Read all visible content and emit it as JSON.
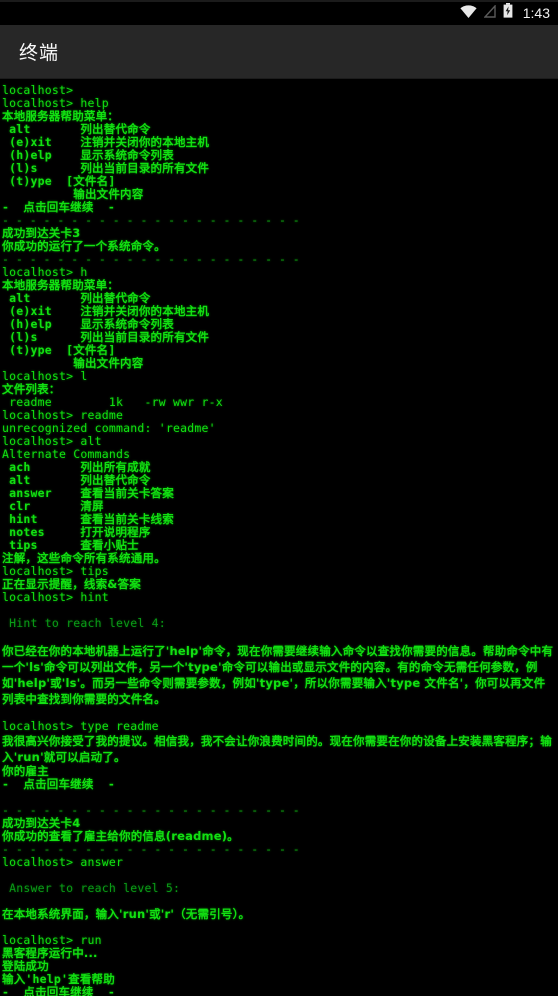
{
  "status_bar": {
    "time": "1:43",
    "icons": [
      "wifi-icon",
      "signal-off-icon",
      "battery-charging-icon"
    ]
  },
  "header": {
    "title": "终端"
  },
  "terminal": {
    "colors": {
      "background": "#000000",
      "text": "#12e012",
      "dim_text": "#0a9b18",
      "header_bg": "#272727",
      "header_text": "#fafafa"
    },
    "lines": [
      {
        "id": "l01",
        "text": "localhost>",
        "style": "mono"
      },
      {
        "id": "l02",
        "text": "localhost> help",
        "style": "mono"
      },
      {
        "id": "l03",
        "text": "本地服务器帮助菜单：",
        "style": "cjk"
      },
      {
        "id": "l04",
        "text": " alt       列出替代命令",
        "style": "mixed"
      },
      {
        "id": "l05",
        "text": " (e)xit    注销并关闭你的本地主机",
        "style": "mixed"
      },
      {
        "id": "l06",
        "text": " (h)elp    显示系统命令列表",
        "style": "mixed"
      },
      {
        "id": "l07",
        "text": " (l)s      列出当前目录的所有文件",
        "style": "mixed"
      },
      {
        "id": "l08",
        "text": " (t)ype  [文件名]",
        "style": "mixed"
      },
      {
        "id": "l09",
        "text": "          输出文件内容",
        "style": "mixed"
      },
      {
        "id": "l10",
        "text": "-  点击回车继续  -",
        "style": "mixed"
      },
      {
        "id": "l11",
        "text": "- - - - - - - - - - - - - - - - - - - - - -",
        "style": "sep"
      },
      {
        "id": "l12",
        "text": "成功到达关卡3",
        "style": "cjk"
      },
      {
        "id": "l13",
        "text": "你成功的运行了一个系统命令。",
        "style": "cjk"
      },
      {
        "id": "l14",
        "text": "- - - - - - - - - - - - - - - - - - - - - -",
        "style": "sep"
      },
      {
        "id": "l15",
        "text": "localhost> h",
        "style": "mono"
      },
      {
        "id": "l16",
        "text": "本地服务器帮助菜单：",
        "style": "cjk"
      },
      {
        "id": "l17",
        "text": " alt       列出替代命令",
        "style": "mixed"
      },
      {
        "id": "l18",
        "text": " (e)xit    注销并关闭你的本地主机",
        "style": "mixed"
      },
      {
        "id": "l19",
        "text": " (h)elp    显示系统命令列表",
        "style": "mixed"
      },
      {
        "id": "l20",
        "text": " (l)s      列出当前目录的所有文件",
        "style": "mixed"
      },
      {
        "id": "l21",
        "text": " (t)ype  [文件名]",
        "style": "mixed"
      },
      {
        "id": "l22",
        "text": "          输出文件内容",
        "style": "mixed"
      },
      {
        "id": "l23",
        "text": "localhost> l",
        "style": "mono"
      },
      {
        "id": "l24",
        "text": "文件列表：",
        "style": "cjk"
      },
      {
        "id": "l25",
        "text": " readme        1k   -rw wwr r-x",
        "style": "mono"
      },
      {
        "id": "l26",
        "text": "localhost> readme",
        "style": "mono"
      },
      {
        "id": "l27",
        "text": "unrecognized command: 'readme'",
        "style": "mono"
      },
      {
        "id": "l28",
        "text": "localhost> alt",
        "style": "mono"
      },
      {
        "id": "l29",
        "text": "Alternate Commands",
        "style": "mono"
      },
      {
        "id": "l30",
        "text": " ach       列出所有成就",
        "style": "mixed"
      },
      {
        "id": "l31",
        "text": " alt       列出替代命令",
        "style": "mixed"
      },
      {
        "id": "l32",
        "text": " answer    查看当前关卡答案",
        "style": "mixed"
      },
      {
        "id": "l33",
        "text": " clr       清屏",
        "style": "mixed"
      },
      {
        "id": "l34",
        "text": " hint      查看当前关卡线索",
        "style": "mixed"
      },
      {
        "id": "l35",
        "text": " notes     打开说明程序",
        "style": "mixed"
      },
      {
        "id": "l36",
        "text": " tips      查看小贴士",
        "style": "mixed"
      },
      {
        "id": "l37",
        "text": "注解，这些命令所有系统通用。",
        "style": "cjk"
      },
      {
        "id": "l38",
        "text": "localhost> tips",
        "style": "mono"
      },
      {
        "id": "l39",
        "text": "正在显示提醒，线索&答案",
        "style": "cjk"
      },
      {
        "id": "l40",
        "text": "localhost> hint",
        "style": "mono"
      },
      {
        "id": "l41",
        "text": "",
        "style": "blank"
      },
      {
        "id": "l42",
        "text": " Hint to reach level 4:",
        "style": "dim"
      },
      {
        "id": "l43",
        "text": "",
        "style": "blank"
      },
      {
        "id": "l44",
        "text": "你已经在你的本地机器上运行了'help'命令，现在你需要继续输入命令以查找你需要的信息。帮助命令中有一个'ls'命令可以列出文件，另一个'type'命令可以输出或显示文件的内容。有的命令无需任何参数，例如'help'或'ls'。而另一些命令则需要参数，例如'type'，所以你需要输入'type 文件名'，你可以再文件列表中查找到你需要的文件名。",
        "style": "wrap"
      },
      {
        "id": "l45",
        "text": "",
        "style": "blank"
      },
      {
        "id": "l46",
        "text": "localhost> type readme",
        "style": "mono"
      },
      {
        "id": "l47",
        "text": "我很高兴你接受了我的提议。相信我，我不会让你浪费时间的。现在你需要在你的设备上安装黑客程序；输入'run'就可以启动了。",
        "style": "wrap"
      },
      {
        "id": "l48",
        "text": "你的雇主",
        "style": "cjk"
      },
      {
        "id": "l49",
        "text": "-  点击回车继续  -",
        "style": "mixed"
      },
      {
        "id": "l50",
        "text": "",
        "style": "blank"
      },
      {
        "id": "l51",
        "text": "- - - - - - - - - - - - - - - - - - - - - -",
        "style": "sep"
      },
      {
        "id": "l52",
        "text": "成功到达关卡4",
        "style": "cjk"
      },
      {
        "id": "l53",
        "text": "你成功的查看了雇主给你的信息(readme)。",
        "style": "cjk"
      },
      {
        "id": "l54",
        "text": "- - - - - - - - - - - - - - - - - - - - - -",
        "style": "sep"
      },
      {
        "id": "l55",
        "text": "localhost> answer",
        "style": "mono"
      },
      {
        "id": "l56",
        "text": "",
        "style": "blank"
      },
      {
        "id": "l57",
        "text": " Answer to reach level 5:",
        "style": "dim"
      },
      {
        "id": "l58",
        "text": "",
        "style": "blank"
      },
      {
        "id": "l59",
        "text": "在本地系统界面，输入'run'或'r'（无需引号）。",
        "style": "cjk"
      },
      {
        "id": "l60",
        "text": "",
        "style": "blank"
      },
      {
        "id": "l61",
        "text": "localhost> run",
        "style": "mono"
      },
      {
        "id": "l62",
        "text": "黑客程序运行中...",
        "style": "cjk"
      },
      {
        "id": "l63",
        "text": "登陆成功",
        "style": "cjk"
      },
      {
        "id": "l64",
        "text": "输入'help'查看帮助",
        "style": "mixed"
      },
      {
        "id": "l65",
        "text": "-  点击回车继续  -",
        "style": "mixed"
      }
    ]
  }
}
